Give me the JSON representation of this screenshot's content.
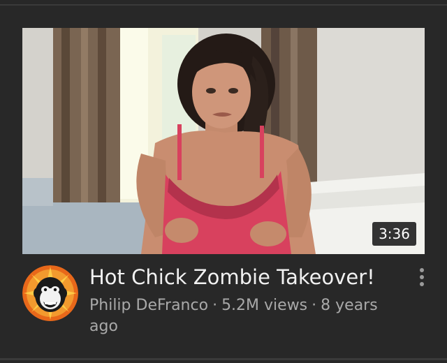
{
  "video": {
    "title": "Hot Chick Zombie Takeover!",
    "duration": "3:36",
    "channel": "Philip DeFranco",
    "views": "5.2M views",
    "age": "8 years ago",
    "separator": "·"
  },
  "icons": {
    "thumbnail": "video-thumbnail-image",
    "avatar": "channel-avatar-chimp-logo",
    "menu": "vertical-ellipsis-icon"
  },
  "colors": {
    "background": "#282828",
    "title": "#f1f1f1",
    "meta": "#a9a9a9",
    "avatar_accent": "#f07a1a"
  }
}
